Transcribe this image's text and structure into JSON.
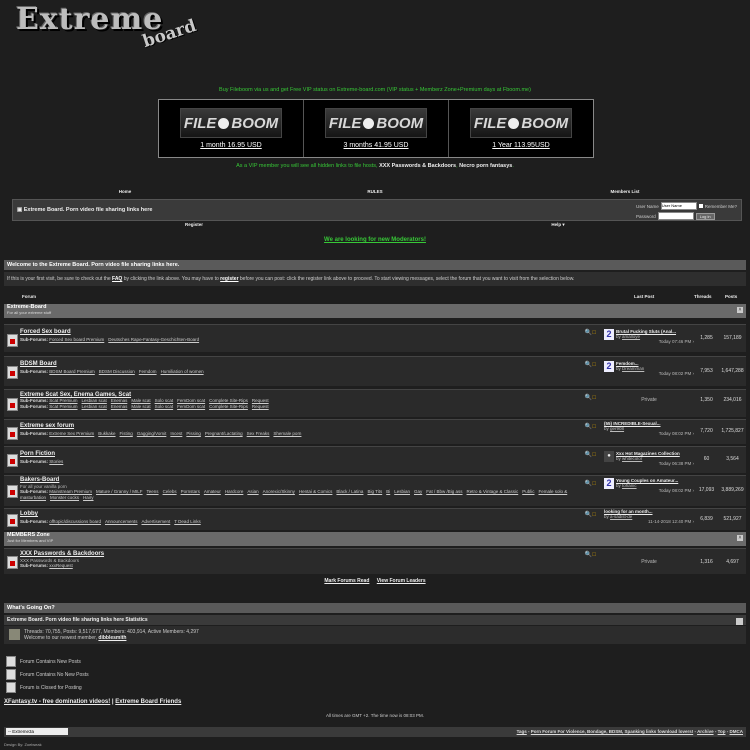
{
  "logo": {
    "word": "Extreme",
    "sub": "board"
  },
  "promo_text": "Buy Fileboom via us and get Free VIP status on Extreme-board.com (VIP status + Memberz Zone+Premium days at Fboom.me)",
  "ads": [
    {
      "brand": "FILE BOOM",
      "label": "1 month 16.95 USD"
    },
    {
      "brand": "FILE BOOM",
      "label": "3 months 41.95 USD"
    },
    {
      "brand": "FILE BOOM",
      "label": "1 Year 113.95USD"
    }
  ],
  "vip_line": {
    "prefix": "As a VIP member you will see all hidden links to file hosts,",
    "link1": "XXX Passwords & Backdoors",
    "sep": ",",
    "link2": "Necro porn fantasys",
    "suffix": "."
  },
  "navbar": [
    "Home",
    "RULES",
    "Members List"
  ],
  "loginbar": {
    "title": "Extreme Board. Porn video file sharing links here",
    "user_label": "User Name",
    "user_value": "User Name",
    "remember": "Remember Me?",
    "pass_label": "Password",
    "button": "Log in"
  },
  "subnav": [
    "Register",
    "Help ▾"
  ],
  "moderators": "We are looking for new Moderators!",
  "welcome": {
    "heading": "Welcome to the Extreme Board. Porn video file sharing links here.",
    "t1": "If this is your first visit, be sure to check out the",
    "faq": "FAQ",
    "t2": "by clicking the link above. You may have to",
    "register": "register",
    "t3": "before you can post: click the register link above to proceed. To start viewing messages, select the forum that you want to visit from the selection below."
  },
  "columns": {
    "forum": "Forum",
    "last_post": "Last Post",
    "threads": "Threads",
    "posts": "Posts"
  },
  "categories": [
    {
      "title": "Extreme-Board",
      "sub": "For all your extreme stuff"
    },
    {
      "title": "MEMBERS Zone",
      "sub": "Just for Members and VIP"
    }
  ],
  "forums": [
    {
      "title": "Forced Sex board",
      "subs": [
        "Forced Sex board Premium",
        "Deutsches Rape-Fantasy-Geschichten-Board"
      ],
      "last_title": "Brutal Fucking Sluts (Anal...",
      "last_by": "by",
      "last_user": "amalloye",
      "last_time": "Today 07:46 PM",
      "threads": "1,285",
      "posts": "157,189"
    },
    {
      "title": "BDSM Board",
      "subs": [
        "BDSM Board Premium",
        "BDSM Discussion",
        "Femdom",
        "Humiliation of women"
      ],
      "last_title": "Femdom...",
      "last_by": "by",
      "last_user": "Dreamman",
      "last_time": "Today 08:02 PM",
      "threads": "7,953",
      "posts": "1,647,288"
    },
    {
      "title": "Extreme Scat Sex, Enema Games, Scat",
      "subs": [
        "Scat Premium",
        "Lesbian scat",
        "Enemas",
        "Male scat",
        "Solo scat",
        "FemDom scat",
        "Complete Site-Rips",
        "Request",
        "Scat Premium",
        "Lesbian scat",
        "Enemas",
        "Male scat",
        "Solo scat",
        "FemDom scat",
        "Complete Site-Rips",
        "Request"
      ],
      "private": "Private",
      "threads": "1,350",
      "posts": "234,016"
    },
    {
      "title": "Extreme sex forum",
      "subs": [
        "Extreme Sex Premium",
        "Bukkake",
        "Fisting",
        "Gagging/Vomit",
        "Incest",
        "Pissing",
        "Pregnant/Lactating",
        "Sex Freaks",
        "Shemale porn"
      ],
      "last_title": "(55) INCREDIBLE-Sexual...",
      "last_by": "by",
      "last_user": "ger908",
      "last_time": "Today 08:02 PM",
      "threads": "7,720",
      "posts": "1,725,827"
    },
    {
      "title": "Porn Fiction",
      "subs": [
        "Stories"
      ],
      "last_title": "Xxx Hot Magazines Collection",
      "last_by": "by",
      "last_user": "whitecolor",
      "last_time": "Today 06:38 PM",
      "threads": "60",
      "posts": "3,564"
    },
    {
      "title": "Bakers-Board",
      "desc": "For all your vanilla porn",
      "subs": [
        "Mainstream Premium",
        "Mature / Granny / MILF",
        "Teens",
        "Celebs",
        "Pornstars",
        "Amateur",
        "Hardcore",
        "Asian",
        "Anorexic/Skinny",
        "Hentai & Comics",
        "Black / Latina",
        "Big Tits",
        "Bi",
        "Lesbian",
        "Gay",
        "Fat / Bbw /Big ass",
        "Retro & Vintage & Classic",
        "Public",
        "Female solo & masturbation",
        "Monster cocks",
        "Hairy"
      ],
      "last_title": "Young Couples on Amateur...",
      "last_by": "by",
      "last_user": "tohanic",
      "last_time": "Today 08:02 PM",
      "threads": "17,093",
      "posts": "3,889,269"
    },
    {
      "title": "Lobby",
      "subs": [
        "offtopic/discussions board",
        "Announcements",
        "Advertisement",
        "T Dead Links"
      ],
      "last_title": "looking for an month...",
      "last_by": "by",
      "last_user": "a-sadist-de",
      "last_time": "11-14-2018 12:40 PM",
      "threads": "6,839",
      "posts": "521,927"
    },
    {
      "title": "XXX Passwords & Backdoors",
      "desc": "XXX Passwords & Backdoors",
      "subs": [
        "xxxRequest"
      ],
      "private": "Private",
      "threads": "1,316",
      "posts": "4,697"
    }
  ],
  "sub_label": "Sub-Forums:",
  "links1": [
    "Mark Forums Read",
    "View Forum Leaders"
  ],
  "wgo": {
    "heading": "What's Going On?",
    "stats_title": "Extreme Board. Porn video file sharing links here Statistics",
    "stats": "Threads: 70,755, Posts: 9,517,677, Members: 403,914, Active Members: 4,297",
    "welcome_pre": "Welcome to our newest member,",
    "newest": "dibblesmith"
  },
  "legend": [
    "Forum Contains New Posts",
    "Forum Contains No New Posts",
    "Forum is Closed for Posting"
  ],
  "friends": {
    "link1": "XFantasy.tv - free domination videos!",
    "sep": "|",
    "link2": "Extreme Board Friends"
  },
  "timezone": "All times are GMT +2. The time now is 08:03 PM.",
  "footer": {
    "style_select": "-- Extreme3a",
    "links": [
      "Tags",
      "Porn Forum For Violence, Bondage, BDSM, Spanking links fownload lovers!",
      "Archive",
      "Top",
      "DMCA"
    ]
  },
  "design": "Design By: Zoelweak"
}
